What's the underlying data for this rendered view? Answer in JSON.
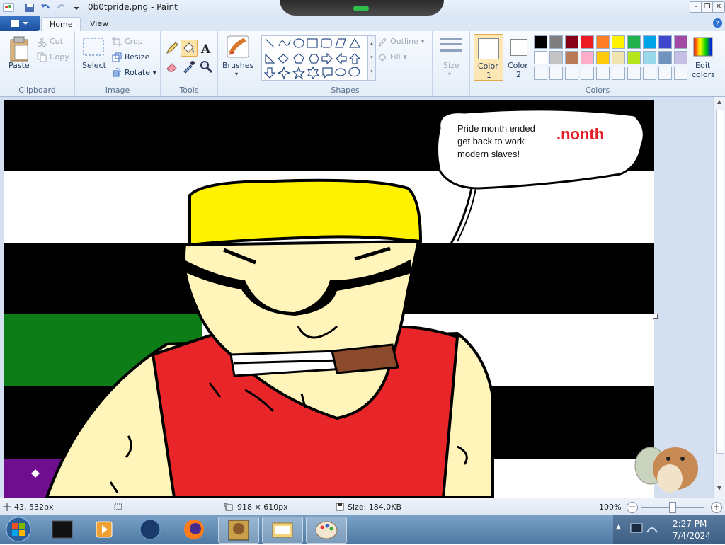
{
  "window": {
    "title": "0b0tpride.png - Paint"
  },
  "tabs": {
    "home": "Home",
    "view": "View"
  },
  "clipboard": {
    "paste": "Paste",
    "cut": "Cut",
    "copy": "Copy",
    "group": "Clipboard"
  },
  "image": {
    "select": "Select",
    "crop": "Crop",
    "resize": "Resize",
    "rotate": "Rotate",
    "group": "Image"
  },
  "tools": {
    "group": "Tools"
  },
  "brushes": {
    "label": "Brushes"
  },
  "shapes": {
    "group": "Shapes",
    "outline": "Outline",
    "fill": "Fill"
  },
  "size": {
    "label": "Size"
  },
  "colors": {
    "color1": "Color\n1",
    "color1_a": "Color",
    "color1_b": "1",
    "color2_a": "Color",
    "color2_b": "2",
    "edit_a": "Edit",
    "edit_b": "colors",
    "group": "Colors",
    "row1": [
      "#000000",
      "#7f7f7f",
      "#880015",
      "#ed1c24",
      "#ff7f27",
      "#fff200",
      "#22b14c",
      "#00a2e8",
      "#3f48cc",
      "#a349a4"
    ],
    "row2": [
      "#ffffff",
      "#c3c3c3",
      "#b97a57",
      "#ffaec9",
      "#ffc90e",
      "#efe4b0",
      "#b5e61d",
      "#99d9ea",
      "#7092be",
      "#c8bfe7"
    ]
  },
  "canvas_text": {
    "bubble_line1": "Pride month ended",
    "bubble_line2": "get back to work",
    "bubble_line3": "modern slaves!",
    "month_fragment": ".nonth"
  },
  "status": {
    "cursor_pos": "43, 532px",
    "canvas_size": "918 × 610px",
    "file_size": "Size: 184.0KB",
    "zoom": "100%"
  },
  "taskbar": {
    "time": "2:27 PM",
    "date": "7/4/2024"
  }
}
